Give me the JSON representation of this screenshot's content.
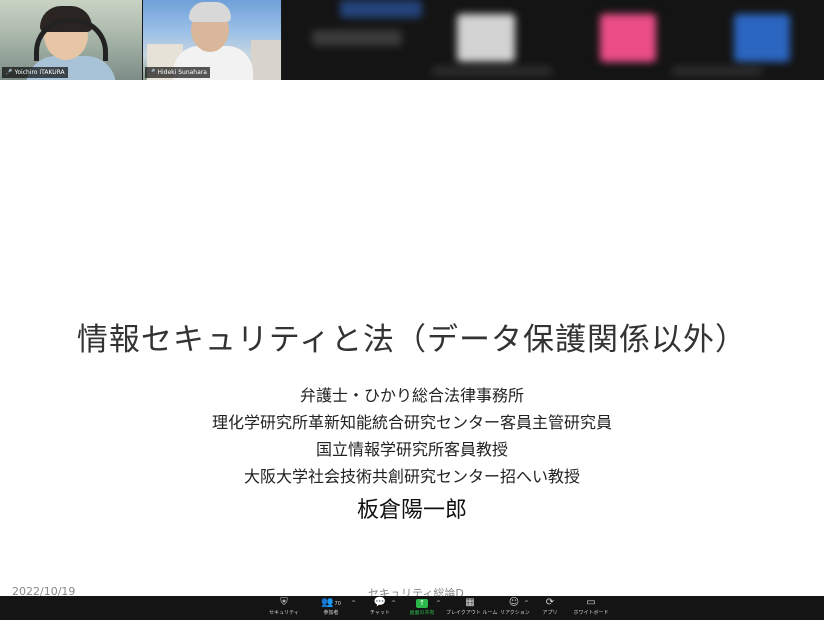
{
  "participants": [
    {
      "name": "Yoichiro ITAKURA",
      "muted": true
    },
    {
      "name": "Hideki Sunahara",
      "muted": true
    }
  ],
  "slide": {
    "title": "情報セキュリティと法（データ保護関係以外）",
    "affiliations": [
      "弁護士・ひかり総合法律事務所",
      "理化学研究所革新知能統合研究センター客員主管研究員",
      "国立情報学研究所客員教授",
      "大阪大学社会技術共創研究センター招へい教授"
    ],
    "author": "板倉陽一郎",
    "footer_date": "2022/10/19",
    "footer_center": "セキュリティ総論D"
  },
  "toolbar": {
    "security": {
      "label": "セキュリティ",
      "icon": "shield-icon"
    },
    "participants": {
      "label": "参加者",
      "count": "70",
      "icon": "people-icon"
    },
    "chat": {
      "label": "チャット",
      "icon": "chat-icon"
    },
    "share": {
      "label": "画面の共有",
      "icon": "share-screen-icon",
      "color": "#2db84c"
    },
    "breakout": {
      "label": "ブレイクアウト ルーム",
      "icon": "breakout-icon"
    },
    "reactions": {
      "label": "リアクション",
      "icon": "reaction-icon"
    },
    "apps": {
      "label": "アプリ",
      "icon": "apps-icon"
    },
    "whiteboard": {
      "label": "ホワイトボード",
      "icon": "whiteboard-icon"
    }
  }
}
